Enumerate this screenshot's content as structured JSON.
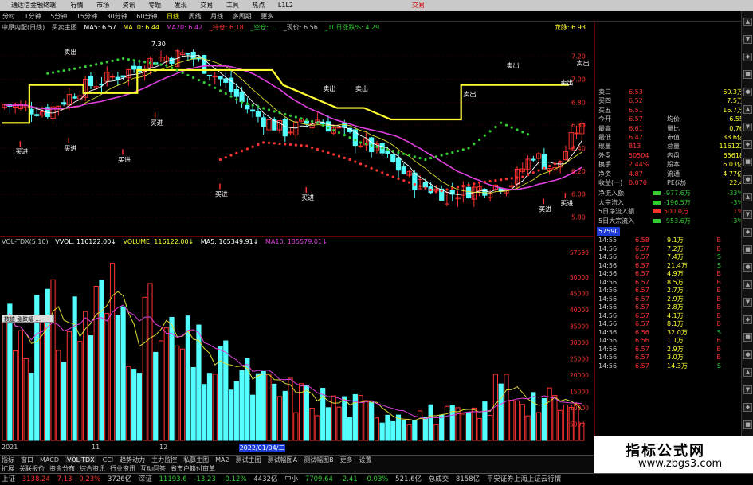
{
  "titlebar": {
    "app_title": "通达信金融终端",
    "menus": [
      "行情",
      "市场",
      "资讯",
      "专题",
      "发现",
      "交易",
      "工具",
      "热点"
    ],
    "right_text": "L1L2",
    "login": "交易"
  },
  "periods": [
    {
      "label": "分时",
      "active": false
    },
    {
      "label": "1分钟",
      "active": false
    },
    {
      "label": "5分钟",
      "active": false
    },
    {
      "label": "15分钟",
      "active": false
    },
    {
      "label": "30分钟",
      "active": false
    },
    {
      "label": "60分钟",
      "active": false
    },
    {
      "label": "日线",
      "active": true
    },
    {
      "label": "周线",
      "active": false
    },
    {
      "label": "月线",
      "active": false
    },
    {
      "label": "多周期",
      "active": false
    },
    {
      "label": "更多",
      "active": false
    }
  ],
  "main_indicator": {
    "name": "中原内配(日线)",
    "formula": "买卖主图",
    "ma5": "MA5: 6.57",
    "ma10": "MA10: 6.44",
    "ma20": "MA20: 6.42",
    "hint1": "_持仓: 6.18",
    "hint2": "_空仓: ...",
    "hint3": "_现价: 6.56",
    "hint4": "_10日涨跌%: 4.29",
    "right": "龙脉: 6.93"
  },
  "main_chart_labels": {
    "peak": "7.30",
    "sell": "卖出",
    "buy": "买进",
    "price_axis": [
      "7.20",
      "7.00",
      "6.80",
      "6.60",
      "6.40",
      "6.20",
      "6.00",
      "5.80"
    ]
  },
  "vol_indicator": {
    "name": "VOL-TDX(5,10)",
    "vvol": "VVOL: 116122.00↓",
    "volume": "VOLUME: 116122.00↓",
    "ma5": "MA5: 165349.91↓",
    "ma10": "MA10: 135579.01↓",
    "axis": [
      "57590",
      "50000",
      "45000",
      "40000",
      "35000",
      "30000",
      "25000",
      "20000",
      "15000",
      "10000",
      "5000"
    ],
    "tooltip": "数值 涨跌幅 ..."
  },
  "timeline": {
    "year": "2021",
    "month": "11",
    "month2": "12",
    "cursor_date": "2022/01/04/二"
  },
  "quote_panel": {
    "rows": [
      {
        "label": "卖三",
        "val": "6.53",
        "right": "60.3万"
      },
      {
        "label": "买四",
        "val": "6.52",
        "right": "7.5万"
      },
      {
        "label": "买五",
        "val": "6.51",
        "right": "16.7万"
      },
      {
        "label": "今开",
        "val": "6.57",
        "label2": "均价",
        "val2": "6.55"
      },
      {
        "label": "最高",
        "val": "6.61",
        "label2": "量比",
        "val2": "0.76"
      },
      {
        "label": "最低",
        "val": "6.47",
        "label2": "市值",
        "val2": "38.6亿"
      },
      {
        "label": "现量",
        "val": "813",
        "label2": "总量",
        "val2": "116122"
      },
      {
        "label": "外盘",
        "val": "50504",
        "label2": "内盘",
        "val2": "65618"
      },
      {
        "label": "换手",
        "val": "2.44%",
        "label2": "股本",
        "val2": "6.03亿"
      },
      {
        "label": "净资",
        "val": "4.87",
        "label2": "流通",
        "val2": "4.77亿"
      },
      {
        "label": "收益(一)",
        "val": "0.070",
        "label2": "PE(动)",
        "val2": "22.4"
      }
    ],
    "flow": [
      {
        "label": "净流入额",
        "val": "-977.6万",
        "pct": "-33%"
      },
      {
        "label": "大宗流入",
        "val": "-196.5万",
        "pct": "-3%"
      },
      {
        "label": "5日净流入额",
        "val": "500.0万",
        "pct": "1%"
      },
      {
        "label": "5日大宗流入",
        "val": "-953.6万",
        "pct": "-3%"
      }
    ],
    "ticks": [
      {
        "t": "14:55",
        "p": "6.58",
        "v": "9.1万",
        "s": "B"
      },
      {
        "t": "14:56",
        "p": "6.57",
        "v": "7.2万",
        "s": "B"
      },
      {
        "t": "14:56",
        "p": "6.57",
        "v": "7.4万",
        "s": "S"
      },
      {
        "t": "14:56",
        "p": "6.57",
        "v": "21.4万",
        "s": "S"
      },
      {
        "t": "14:56",
        "p": "6.57",
        "v": "4.9万",
        "s": "B"
      },
      {
        "t": "14:56",
        "p": "6.57",
        "v": "8.5万",
        "s": "B"
      },
      {
        "t": "14:56",
        "p": "6.57",
        "v": "2.7万",
        "s": "B"
      },
      {
        "t": "14:56",
        "p": "6.57",
        "v": "2.9万",
        "s": "B"
      },
      {
        "t": "14:56",
        "p": "6.57",
        "v": "2.8万",
        "s": "B"
      },
      {
        "t": "14:56",
        "p": "6.57",
        "v": "4.1万",
        "s": "B"
      },
      {
        "t": "14:56",
        "p": "6.57",
        "v": "8.1万",
        "s": "B"
      },
      {
        "t": "14:56",
        "p": "6.56",
        "v": "32.0万",
        "s": "S"
      },
      {
        "t": "14:56",
        "p": "6.56",
        "v": "1.1万",
        "s": "B"
      },
      {
        "t": "14:56",
        "p": "6.57",
        "v": "2.9万",
        "s": "B"
      },
      {
        "t": "14:56",
        "p": "6.57",
        "v": "3.0万",
        "s": "B"
      },
      {
        "t": "14:56",
        "p": "6.57",
        "v": "14.3万",
        "s": "S"
      }
    ],
    "top_value": "57590"
  },
  "bottom_tabs": [
    "指标",
    "窗口",
    "MACD",
    "VOL-TDX",
    "CCI",
    "趋势动力",
    "主力监控",
    "私募主图",
    "MA2",
    "测试主图",
    "测试幅图A",
    "测试幅图B",
    "更多",
    "设置"
  ],
  "active_tab": "VOL-TDX",
  "bottom_tabs2": [
    "扩展",
    "关联报价",
    "资金分布",
    "综合资讯",
    "行业资讯",
    "互动问答",
    "省市户籍付审单"
  ],
  "status": {
    "sh": {
      "name": "上证",
      "val": "3138.24",
      "chg": "7.13",
      "pct": "0.23%",
      "amt": "3726亿"
    },
    "sz": {
      "name": "深证",
      "val": "11193.6",
      "chg": "-13.23",
      "pct": "-0.12%",
      "amt": "4432亿"
    },
    "zx": {
      "name": "中小",
      "val": "7709.64",
      "chg": "-2.41",
      "pct": "-0.03%",
      "amt": "521.6亿"
    },
    "total": {
      "name": "总成交",
      "val": "8158亿"
    },
    "broker": "平安证券上海上证云行情"
  },
  "watermark": {
    "big": "指标公式网",
    "small": "www.zbgs3.com"
  },
  "colors": {
    "up": "#ff3232",
    "down": "#54ffff",
    "yellow": "#ffff33",
    "magenta": "#e040e0",
    "green": "#33cc33"
  },
  "chart_data": {
    "type": "candlestick",
    "price_range": [
      5.7,
      7.35
    ],
    "bars": 108,
    "volume_range": [
      0,
      57590
    ]
  }
}
